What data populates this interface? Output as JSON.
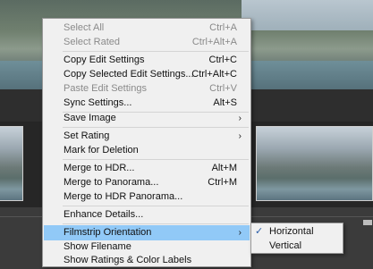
{
  "context_menu": {
    "items": [
      {
        "label": "Select All",
        "shortcut": "Ctrl+A",
        "disabled": true
      },
      {
        "label": "Select Rated",
        "shortcut": "Ctrl+Alt+A",
        "disabled": true
      },
      {
        "label": "Copy Edit Settings",
        "shortcut": "Ctrl+C"
      },
      {
        "label": "Copy Selected Edit Settings...",
        "shortcut": "Ctrl+Alt+C"
      },
      {
        "label": "Paste Edit Settings",
        "shortcut": "Ctrl+V",
        "disabled": true
      },
      {
        "label": "Sync Settings...",
        "shortcut": "Alt+S"
      },
      {
        "label": "Save Image",
        "submenu": true
      },
      {
        "label": "Set Rating",
        "submenu": true
      },
      {
        "label": "Mark for Deletion"
      },
      {
        "label": "Merge to HDR...",
        "shortcut": "Alt+M"
      },
      {
        "label": "Merge to Panorama...",
        "shortcut": "Ctrl+M"
      },
      {
        "label": "Merge to HDR Panorama..."
      },
      {
        "label": "Enhance Details..."
      },
      {
        "label": "Filmstrip Orientation",
        "submenu": true,
        "highlighted": true
      },
      {
        "label": "Show Filename"
      },
      {
        "label": "Show Ratings & Color Labels"
      }
    ]
  },
  "submenu": {
    "items": [
      {
        "label": "Horizontal",
        "checked": true
      },
      {
        "label": "Vertical"
      }
    ]
  },
  "icons": {
    "submenu_arrow": "chevron-right-icon",
    "check": "checkmark-icon"
  },
  "colors": {
    "menu_bg": "#f0f0f0",
    "highlight": "#91c9f7",
    "disabled_text": "#8a8a8a"
  }
}
